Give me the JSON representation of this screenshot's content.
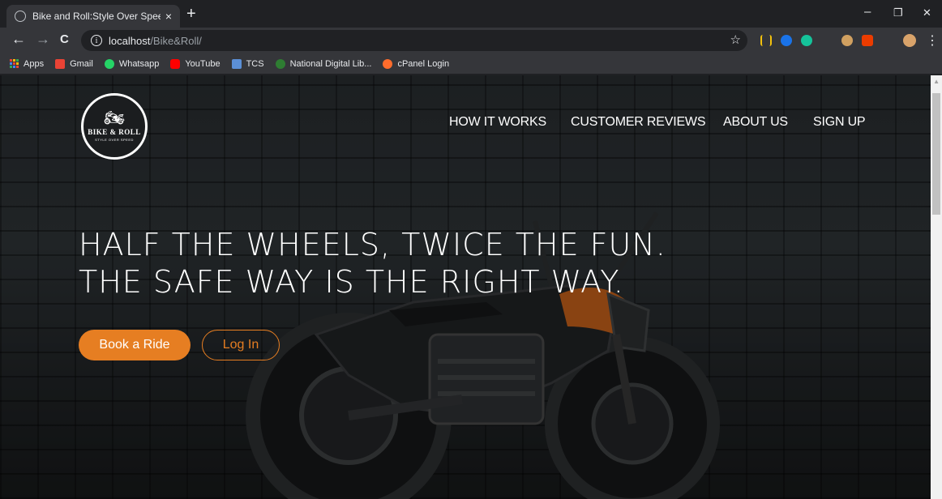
{
  "browser": {
    "tab_title": "Bike and Roll:Style Over Speed!!!",
    "tab_close": "×",
    "new_tab": "+",
    "url_host": "localhost",
    "url_path": "/Bike&Roll/",
    "info_glyph": "i",
    "star_glyph": "☆",
    "back_glyph": "←",
    "forward_glyph": "→",
    "reload_glyph": "C",
    "minimize_glyph": "–",
    "restore_glyph": "❐",
    "close_glyph": "✕",
    "menu_glyph": "⋮",
    "bookmarks": [
      {
        "label": "Apps",
        "icon": "apps-grid-icon"
      },
      {
        "label": "Gmail",
        "icon": "gmail-icon"
      },
      {
        "label": "Whatsapp",
        "icon": "whatsapp-icon"
      },
      {
        "label": "YouTube",
        "icon": "youtube-icon"
      },
      {
        "label": "TCS",
        "icon": "tcs-icon"
      },
      {
        "label": "National Digital Lib...",
        "icon": "ndl-icon"
      },
      {
        "label": "cPanel Login",
        "icon": "cpanel-icon"
      }
    ]
  },
  "site": {
    "logo": {
      "brand": "BIKE & ROLL",
      "tagline": "STYLE OVER SPEED",
      "glyph": "🏍"
    },
    "nav": [
      {
        "label": "HOW IT WORKS"
      },
      {
        "label": "CUSTOMER REVIEWS"
      },
      {
        "label": "ABOUT US"
      },
      {
        "label": "SIGN UP"
      }
    ],
    "headline": {
      "line1": "HALF THE WHEELS, TWICE THE FUN.",
      "line2": "THE SAFE WAY IS THE RIGHT WAY."
    },
    "buttons": {
      "book": "Book a Ride",
      "login": "Log In"
    }
  },
  "colors": {
    "accent": "#e67e22",
    "chrome_dark": "#202124",
    "chrome_mid": "#35363a"
  }
}
